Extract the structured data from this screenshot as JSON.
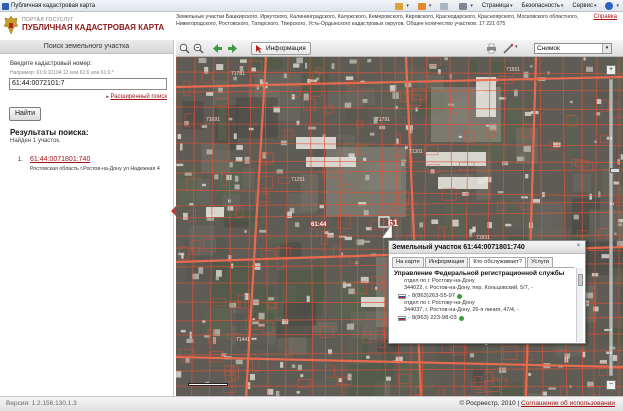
{
  "browser": {
    "tab_title": "Публичная кадастровая карта",
    "page_menu": "Страница",
    "safety_menu": "Безопасность",
    "service_menu": "Сервис",
    "help_icon": "help-icon"
  },
  "header": {
    "portal": "ПОРТАЛ ГОСУСЛУГ",
    "site_name": "ПУБЛИЧНАЯ КАДАСТРОВАЯ КАРТА",
    "regions_text": "Земельные участки Башкирского, Иркутского, Калининградского, Калужского, Кемеровского, Кировского, Краснодарского, Красноярского, Московского областного, Нижегородского, Ростовского, Татарского, Тверского, Усть-Ордынского кадастровых округов. Общее количество участков: 17 221 075",
    "more_link": "Справка"
  },
  "search": {
    "title": "Поиск земельного участка",
    "input_label": "Введите кадастровый номер:",
    "example": "Например: 61:6:10104:12 или 61:6 или 61:6:*",
    "value": "61:44:0072101:7",
    "advanced_link": "Расширенный поиск",
    "find_button": "Найти"
  },
  "results": {
    "heading": "Результаты поиска:",
    "found": "Найден 1 участок.",
    "items": [
      {
        "num": "1.",
        "cad": "61:44:0071801:740",
        "addr": "Ростовская область г.Ростов-на-Дону ул Надежная 4"
      }
    ]
  },
  "toolbar": {
    "info_button": "Информация",
    "layer_select": "Снимок"
  },
  "map": {
    "labels": [
      "71781",
      "71791",
      "71251",
      "71301",
      "61:44",
      "61",
      "71691",
      "71831",
      "71561",
      "71441"
    ],
    "scale_label": ""
  },
  "popup": {
    "title": "Земельный участок 61:44:0071801:740",
    "tabs": [
      "На карте",
      "Информация",
      "Кто обслуживает?",
      "Услуги"
    ],
    "active_tab": 2,
    "org": "Управление Федеральной регистрационной службы",
    "dept1": "отдел по г. Ростову-на-Дону",
    "addr1": "344022, г. Ростов-на-Дону, пер. Кольцовский, 5/7, -",
    "tel1": "8(863)263-55-97",
    "dept2": "отдел по г. Ростову-на-Дону",
    "addr2": "344037, г. Ростов-на-Дону, 26-я линия, 47/4, -",
    "tel2": "8(863) 223-98-03"
  },
  "footer": {
    "version": "Версия: 1.2.156.130.1.3",
    "copyright": "© Росреестр, 2010 |",
    "terms": "Соглашение об использовании"
  },
  "colors": {
    "accent": "#a31515",
    "plot_line": "#e0533a"
  }
}
